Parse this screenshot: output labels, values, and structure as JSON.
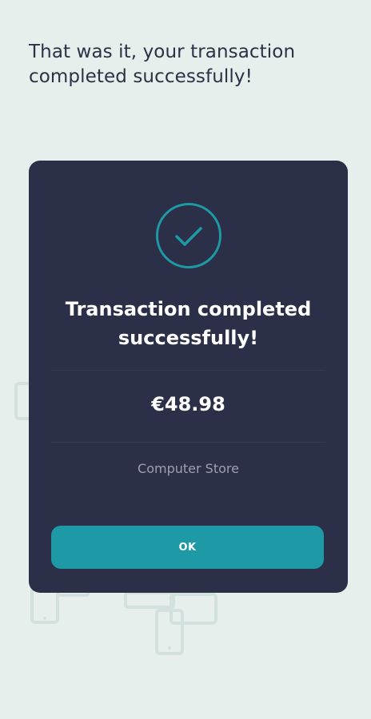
{
  "page": {
    "headline": "That was it, your transaction completed successfully!"
  },
  "card": {
    "status_icon": "check-circle-icon",
    "title": "Transaction completed successfully!",
    "amount": "€48.98",
    "merchant": "Computer Store",
    "ok_label": "OK"
  },
  "colors": {
    "background": "#e7efec",
    "card": "#2b2f47",
    "accent": "#1d9aa6",
    "headline_text": "#2b3146",
    "muted_text": "#9da0b0"
  }
}
